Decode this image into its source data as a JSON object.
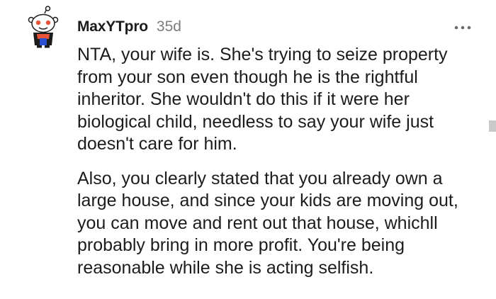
{
  "comment": {
    "username": "MaxYTpro",
    "timestamp": "35d",
    "paragraphs": [
      "NTA, your wife is. She's trying to seize property from your son even though he is the rightful inheritor. She wouldn't do this if it were her biological child, needless to say your wife just doesn't care for him.",
      "Also, you clearly stated that you already own a large house, and since your kids are moving out, you can move and rent out that house, whichll probably bring in more profit. You're being reasonable while she is acting selfish."
    ],
    "avatar_icon": "snoo-avatar-icon",
    "menu_icon": "more-options-icon"
  },
  "colors": {
    "text": "#1c1c1c",
    "meta": "#7c7c7c",
    "avatar_accent": "#e8543a",
    "avatar_shirt": "#2a4fd0"
  }
}
